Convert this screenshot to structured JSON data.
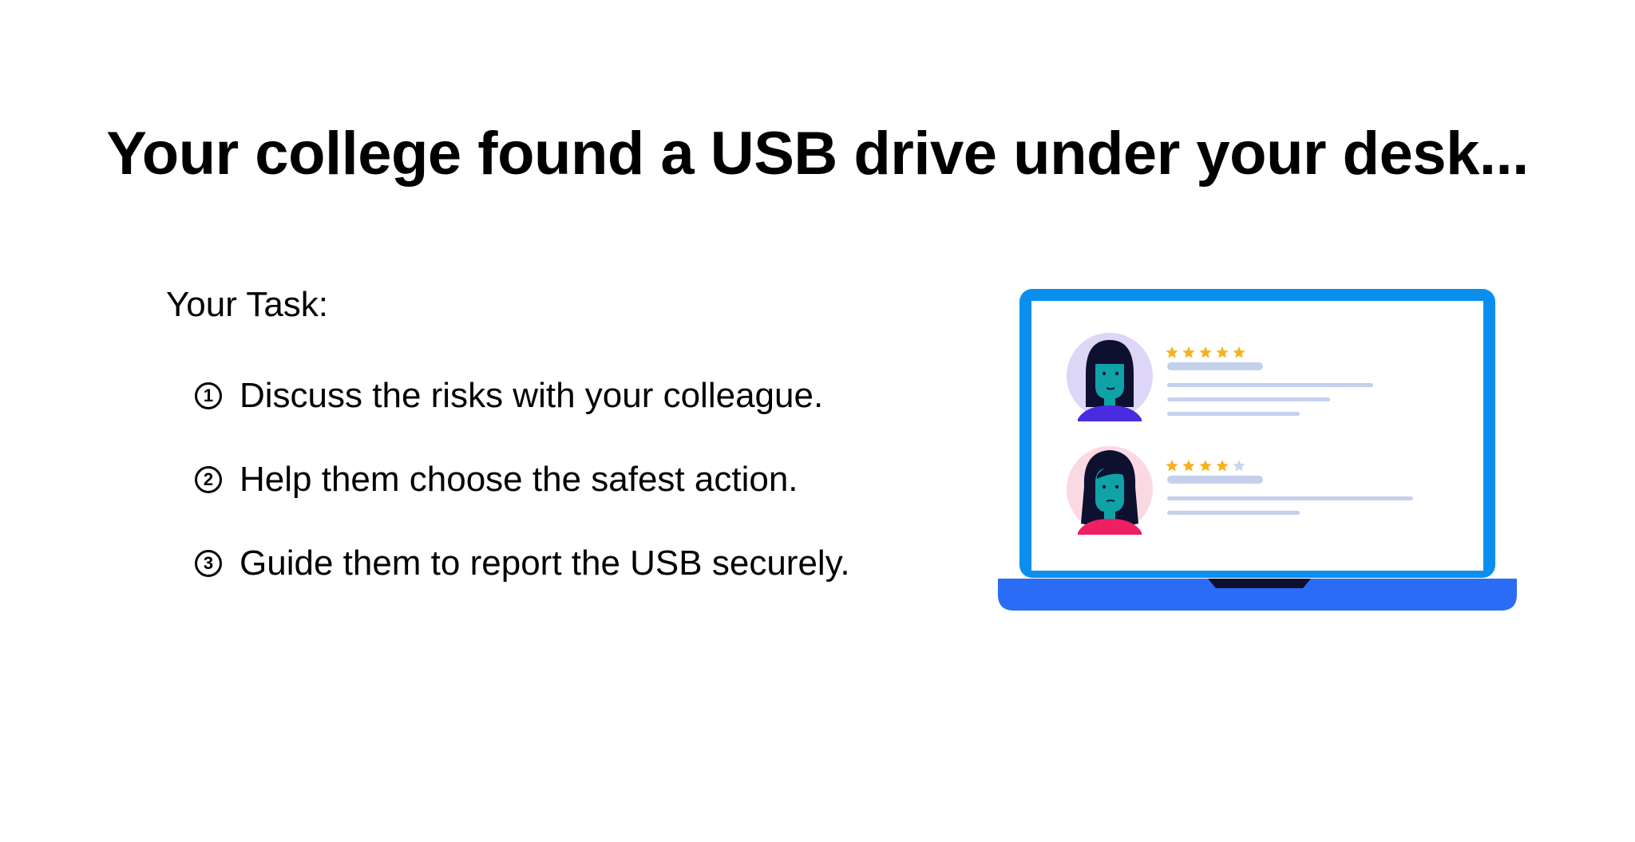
{
  "slide": {
    "title": "Your college found a USB drive under your desk...",
    "task_heading": "Your Task:",
    "steps": [
      {
        "number": "1",
        "text": "Discuss the risks with your colleague."
      },
      {
        "number": "2",
        "text": "Help them choose the safest action."
      },
      {
        "number": "3",
        "text": "Guide them to report the USB securely."
      }
    ]
  },
  "illustration": {
    "icon": "laptop-reviews-illustration",
    "reviews": [
      {
        "rating": 5,
        "max": 5
      },
      {
        "rating": 4,
        "max": 5
      }
    ],
    "colors": {
      "laptop_frame": "#0A8FEF",
      "laptop_base": "#2B6CF6",
      "star_filled": "#F7B21B",
      "star_empty": "#C9D6E8",
      "placeholder_lines": "#C5D0EC",
      "avatar_bg_1": "#DDD6F7",
      "avatar_bg_2": "#FBD9E3",
      "skin": "#0FA3A7",
      "hair": "#0E1030"
    }
  }
}
